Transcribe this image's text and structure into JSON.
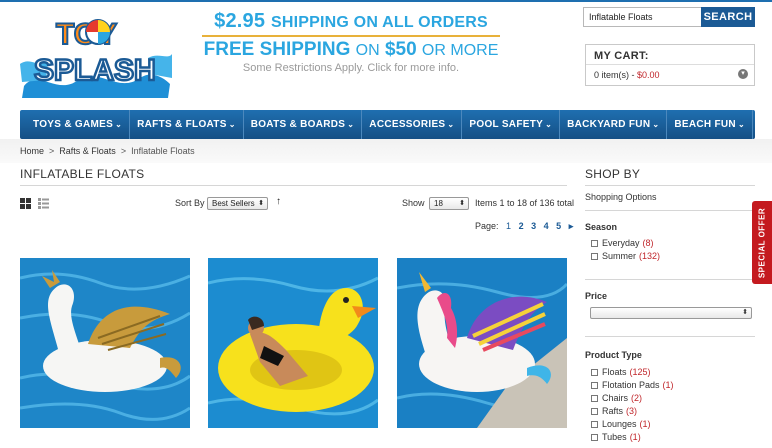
{
  "brand": {
    "logo_top": "TOY",
    "logo_bottom": "SPLASH"
  },
  "promo": {
    "line1_price": "$2.95",
    "line1_rest": "SHIPPING ON ALL ORDERS",
    "line2_a": "FREE SHIPPING",
    "line2_on": "ON",
    "line2_amount": "$50",
    "line2_more": "OR MORE",
    "line3": "Some Restrictions Apply. Click for more info."
  },
  "search": {
    "value": "Inflatable Floats",
    "button": "SEARCH"
  },
  "cart": {
    "title": "MY CART:",
    "count": "0 item(s)",
    "dash": " - ",
    "total": "$0.00"
  },
  "nav": [
    {
      "label": "TOYS & GAMES"
    },
    {
      "label": "RAFTS & FLOATS"
    },
    {
      "label": "BOATS & BOARDS"
    },
    {
      "label": "ACCESSORIES"
    },
    {
      "label": "POOL SAFETY"
    },
    {
      "label": "BACKYARD FUN"
    },
    {
      "label": "BEACH FUN"
    }
  ],
  "breadcrumb": {
    "home": "Home",
    "sep": ">",
    "parent": "Rafts & Floats",
    "current": "Inflatable Floats"
  },
  "page_title": "INFLATABLE FLOATS",
  "toolbar": {
    "sort_label": "Sort By",
    "sort_value": "Best Sellers",
    "sort_dir": "↑",
    "show_label": "Show",
    "show_value": "18",
    "items_text": "Items 1 to 18 of 136 total",
    "page_label": "Page:",
    "pages": [
      "1",
      "2",
      "3",
      "4",
      "5"
    ],
    "next": "▸"
  },
  "products": [
    {
      "name": "pegasus-float"
    },
    {
      "name": "duck-float"
    },
    {
      "name": "unicorn-float"
    }
  ],
  "sidebar": {
    "title": "SHOP BY",
    "options_label": "Shopping Options",
    "season": {
      "title": "Season",
      "items": [
        {
          "label": "Everyday",
          "count": "(8)"
        },
        {
          "label": "Summer",
          "count": "(132)"
        }
      ]
    },
    "price": {
      "title": "Price"
    },
    "product_type": {
      "title": "Product Type",
      "items": [
        {
          "label": "Floats",
          "count": "(125)"
        },
        {
          "label": "Flotation Pads",
          "count": "(1)"
        },
        {
          "label": "Chairs",
          "count": "(2)"
        },
        {
          "label": "Rafts",
          "count": "(3)"
        },
        {
          "label": "Lounges",
          "count": "(1)"
        },
        {
          "label": "Tubes",
          "count": "(1)"
        }
      ]
    }
  },
  "special_offer": "SPECIAL OFFER",
  "colors": {
    "nav": "#1b5a95",
    "accent_blue": "#2ba6e0",
    "sale_red": "#c0262b",
    "special": "#c41a1f"
  }
}
